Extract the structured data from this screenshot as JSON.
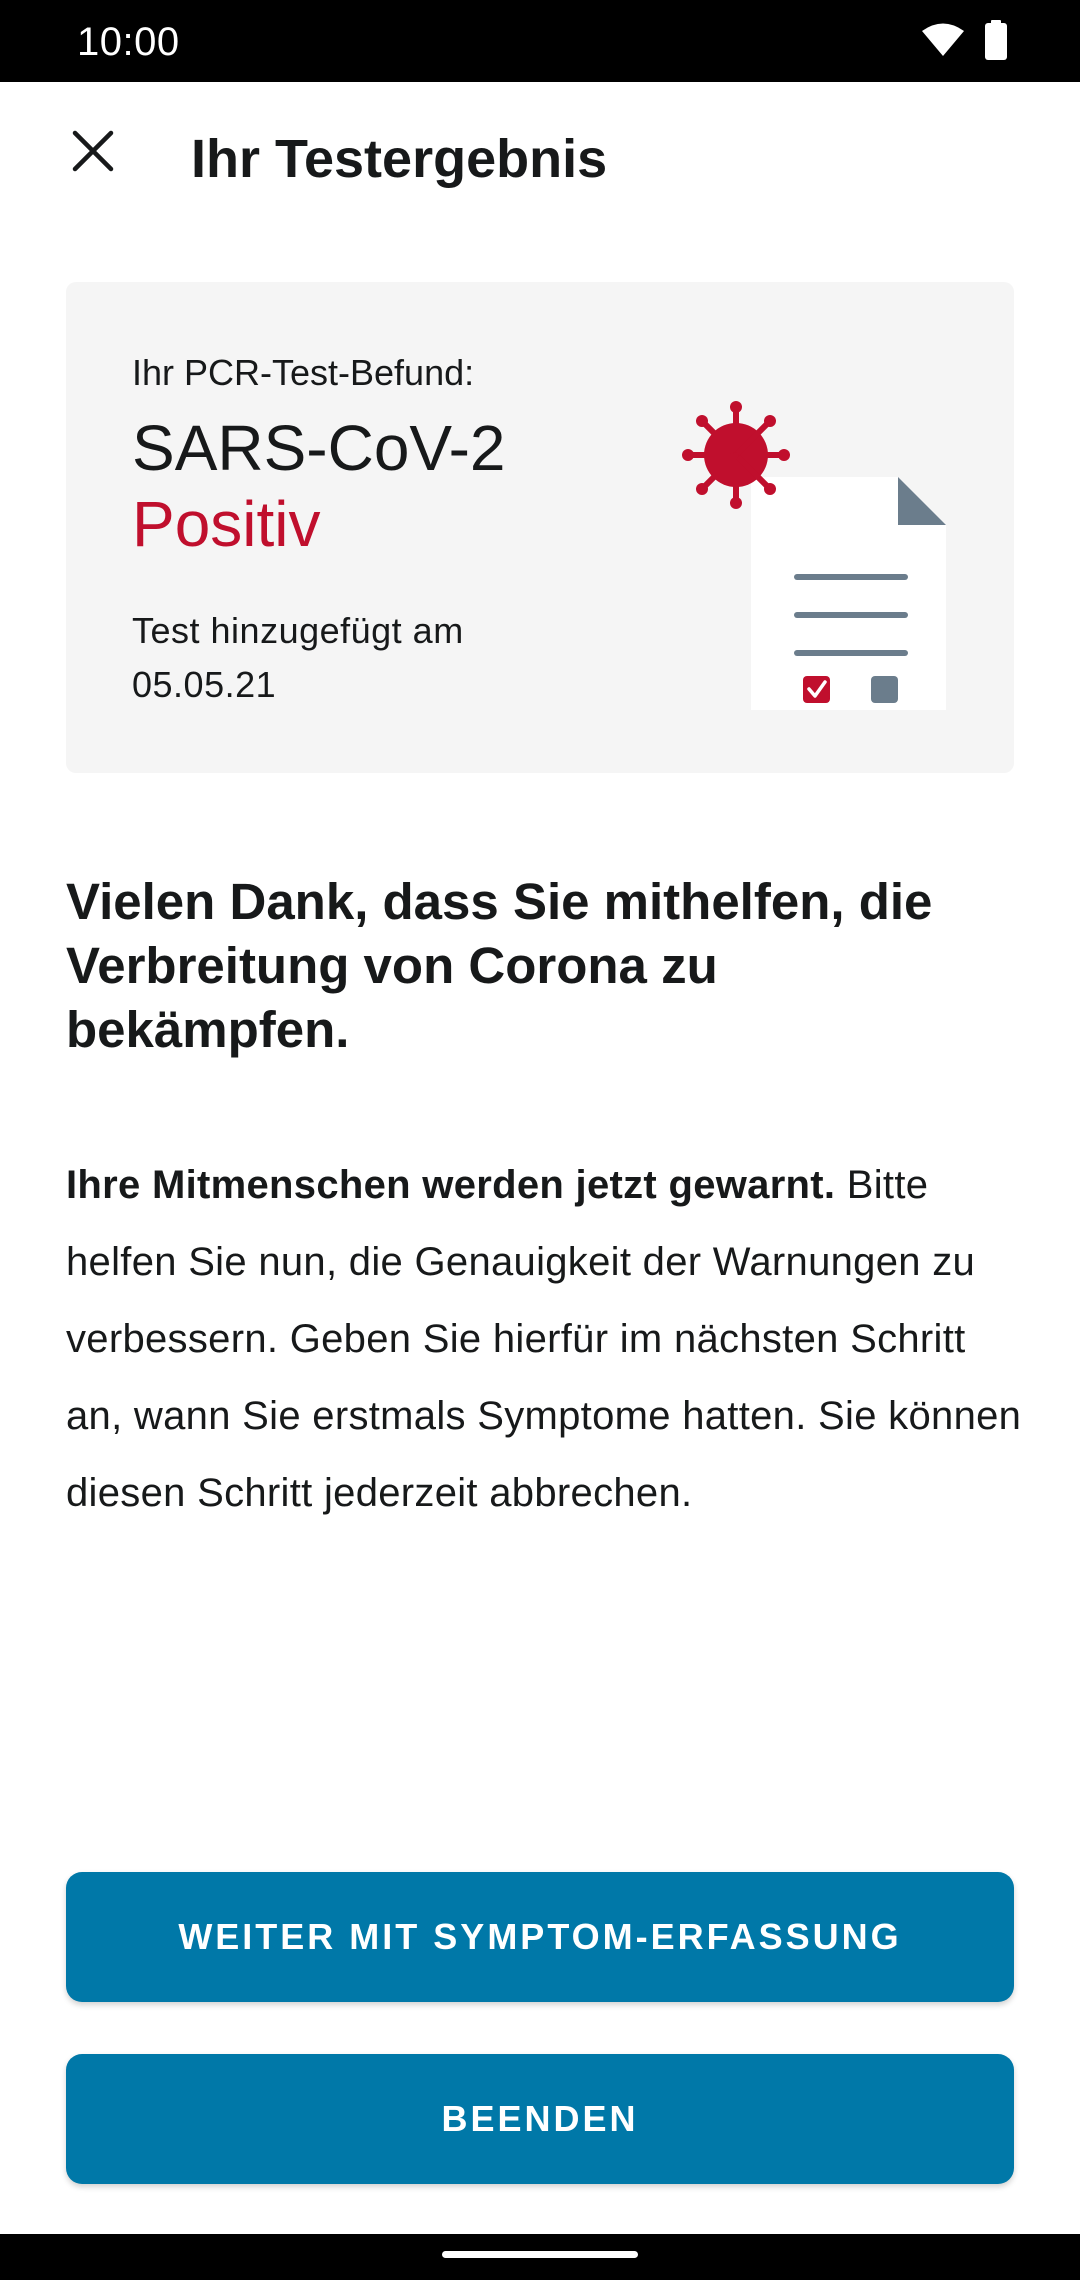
{
  "status_bar": {
    "time": "10:00",
    "icons": [
      "wifi-icon",
      "battery-icon"
    ]
  },
  "toolbar": {
    "close_icon": "close-icon",
    "title": "Ihr Testergebnis"
  },
  "result_card": {
    "label": "Ihr PCR-Test-Befund:",
    "virus_name": "SARS-CoV-2",
    "result": "Positiv",
    "date_label": "Test hinzugefügt am",
    "date_value": "05.05.21",
    "illustration_icon": "test-document-virus-icon"
  },
  "headline": "Vielen Dank, dass Sie mithelfen, die Verbreitung von Corona zu bekämpfen.",
  "body": {
    "strong": "Ihre Mitmenschen werden jetzt gewarnt.",
    "text": " Bitte helfen Sie nun, die Genauigkeit der Warnungen zu verbessern. Geben Sie hierfür im nächsten Schritt an, wann Sie erstmals Symptome hatten. Sie können diesen Schritt jederzeit abbrechen."
  },
  "buttons": {
    "primary_label": "WEITER MIT SYMPTOM-ERFASSUNG",
    "secondary_label": "BEENDEN"
  },
  "colors": {
    "accent": "#0078a8",
    "positive_red": "#c00f2d",
    "card_background": "#f5f5f5",
    "text": "#17191a"
  }
}
